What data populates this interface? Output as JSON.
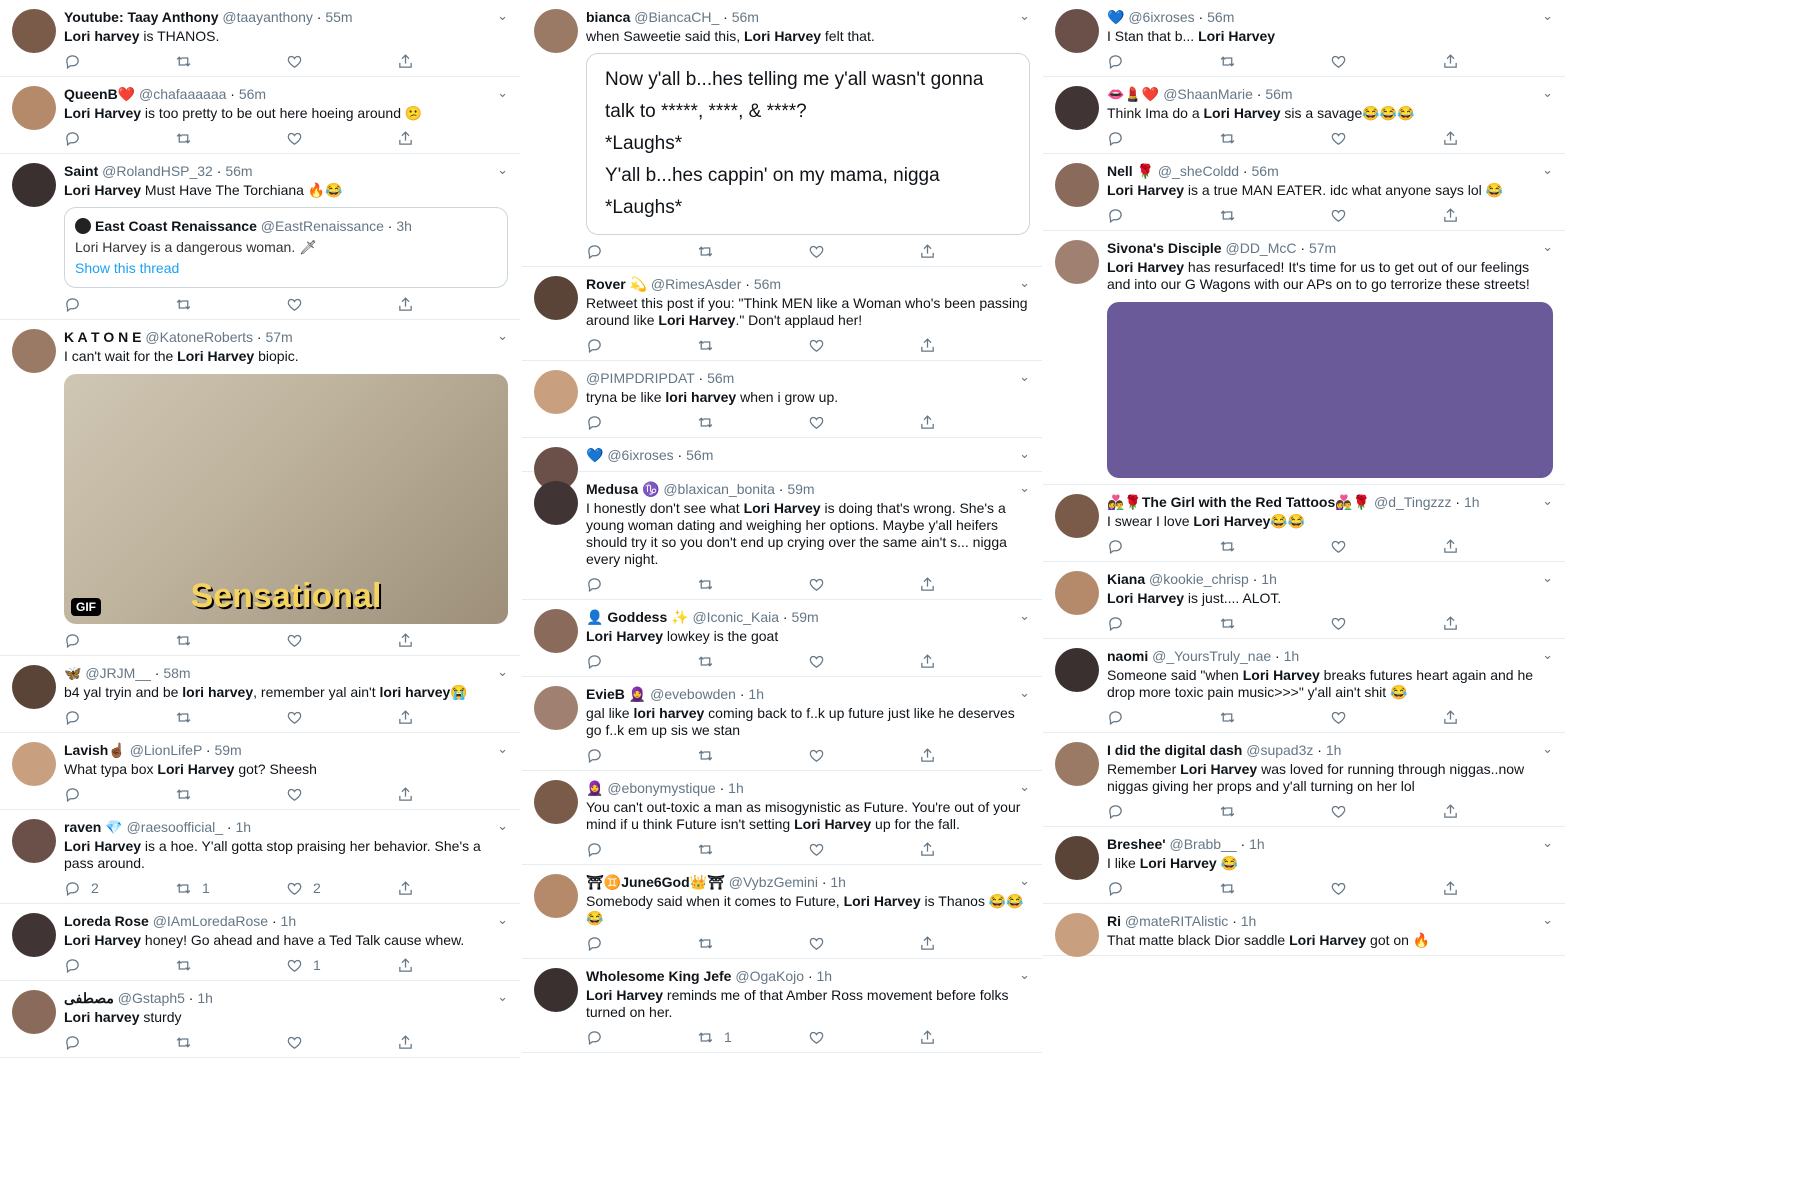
{
  "columns": [
    [
      {
        "name": "Youtube: Taay Anthony",
        "handle": "@taayanthony",
        "time": "55m",
        "text": [
          {
            "t": "Lori harvey",
            "b": true
          },
          {
            "t": " is THANOS."
          }
        ]
      },
      {
        "name": "QueenB❤️",
        "handle": "@chafaaaaaa",
        "time": "56m",
        "text": [
          {
            "t": "Lori Harvey",
            "b": true
          },
          {
            "t": " is too pretty to be out here hoeing around 😕"
          }
        ]
      },
      {
        "name": "Saint",
        "handle": "@RolandHSP_32",
        "time": "56m",
        "text": [
          {
            "t": "Lori Harvey",
            "b": true
          },
          {
            "t": " Must Have The Torchiana 🔥😂"
          }
        ],
        "quote": {
          "name": "East Coast Renaissance",
          "handle": "@EastRenaissance",
          "time": "3h",
          "text": "Lori Harvey is a dangerous woman. 🗡",
          "link": "Show this thread"
        }
      },
      {
        "name": "K A T O N E",
        "handle": "@KatoneRoberts",
        "time": "57m",
        "text": [
          {
            "t": "I can't wait for the "
          },
          {
            "t": "Lori Harvey",
            "b": true
          },
          {
            "t": " biopic."
          }
        ],
        "gif": {
          "caption": "Sensational",
          "badge": "GIF"
        }
      },
      {
        "name": "🦋",
        "handle": "@JRJM__",
        "time": "58m",
        "text": [
          {
            "t": "b4 yal tryin and be "
          },
          {
            "t": "lori harvey",
            "b": true
          },
          {
            "t": ", remember yal ain't "
          },
          {
            "t": "lori harvey",
            "b": true
          },
          {
            "t": "😭"
          }
        ]
      },
      {
        "name": "Lavish☝🏾",
        "handle": "@LionLifeP",
        "time": "59m",
        "text": [
          {
            "t": "What typa box "
          },
          {
            "t": "Lori Harvey",
            "b": true
          },
          {
            "t": " got? Sheesh"
          }
        ]
      },
      {
        "name": "raven 💎",
        "handle": "@raesoofficial_",
        "time": "1h",
        "text": [
          {
            "t": "Lori Harvey",
            "b": true
          },
          {
            "t": " is a hoe. Y'all gotta stop praising her behavior. She's a pass around."
          }
        ],
        "counts": {
          "reply": "2",
          "retweet": "1",
          "like": "2"
        }
      },
      {
        "name": "Loreda Rose",
        "handle": "@IAmLoredaRose",
        "time": "1h",
        "text": [
          {
            "t": "Lori Harvey",
            "b": true
          },
          {
            "t": " honey! Go ahead and have a Ted Talk cause whew."
          }
        ],
        "counts": {
          "like": "1"
        }
      },
      {
        "name": "مصطفى",
        "handle": "@Gstaph5",
        "time": "1h",
        "text": [
          {
            "t": "Lori harvey",
            "b": true
          },
          {
            "t": " sturdy"
          }
        ]
      }
    ],
    [
      {
        "name": "bianca",
        "handle": "@BiancaCH_",
        "time": "56m",
        "text": [
          {
            "t": "when Saweetie said this, "
          },
          {
            "t": "Lori Harvey",
            "b": true
          },
          {
            "t": " felt that."
          }
        ],
        "lyrics": [
          "Now y'all b...hes telling me y'all wasn't gonna",
          "talk to *****, ****, & ****?",
          "*Laughs*",
          "Y'all b...hes cappin' on my mama, nigga",
          "*Laughs*"
        ]
      },
      {
        "name": "Rover 💫",
        "handle": "@RimesAsder",
        "time": "56m",
        "text": [
          {
            "t": "Retweet this post if you: \"Think MEN like a Woman who's been passing around like "
          },
          {
            "t": "Lori Harvey",
            "b": true
          },
          {
            "t": ".\" Don't applaud her!"
          }
        ]
      },
      {
        "name": "",
        "handle": "@PIMPDRIPDAT",
        "time": "56m",
        "text": [
          {
            "t": "tryna be like "
          },
          {
            "t": "lori harvey",
            "b": true
          },
          {
            "t": " when i grow up."
          }
        ]
      },
      {
        "name": "💙",
        "handle": "@6ixroses",
        "time": "56m",
        "text": [],
        "noActions": true
      },
      {
        "name": "Medusa ♑",
        "handle": "@blaxican_bonita",
        "time": "59m",
        "text": [
          {
            "t": "I honestly don't see what "
          },
          {
            "t": "Lori Harvey",
            "b": true
          },
          {
            "t": " is doing that's wrong. She's a young woman dating and weighing her options. Maybe y'all heifers should try it so you don't end up crying over the same ain't s... nigga every night."
          }
        ]
      },
      {
        "name": "👤 Goddess ✨",
        "handle": "@Iconic_Kaia",
        "time": "59m",
        "text": [
          {
            "t": "Lori Harvey",
            "b": true
          },
          {
            "t": " lowkey is the goat"
          }
        ]
      },
      {
        "name": "EvieB 🧕",
        "handle": "@evebowden",
        "time": "1h",
        "text": [
          {
            "t": "gal like "
          },
          {
            "t": "lori harvey",
            "b": true
          },
          {
            "t": " coming back to f..k up future just like he deserves go f..k em up sis we stan"
          }
        ]
      },
      {
        "name": "🧕",
        "handle": "@ebonymystique",
        "time": "1h",
        "text": [
          {
            "t": "You can't out-toxic a man as misogynistic as Future. You're out of your mind if u think Future isn't setting "
          },
          {
            "t": "Lori Harvey",
            "b": true
          },
          {
            "t": " up for the fall."
          }
        ]
      },
      {
        "name": "⛩♊June6God👑⛩",
        "handle": "@VybzGemini",
        "time": "1h",
        "text": [
          {
            "t": "Somebody said when it comes to Future, "
          },
          {
            "t": "Lori Harvey",
            "b": true
          },
          {
            "t": " is Thanos 😂😂😂"
          }
        ]
      },
      {
        "name": "Wholesome King Jefe",
        "handle": "@OgaKojo",
        "time": "1h",
        "text": [
          {
            "t": "Lori Harvey",
            "b": true
          },
          {
            "t": " reminds me of that Amber Ross movement before folks turned on her."
          }
        ],
        "counts": {
          "retweet": "1"
        }
      }
    ],
    [
      {
        "name": "💙",
        "handle": "@6ixroses",
        "time": "56m",
        "text": [
          {
            "t": "I Stan that b... "
          },
          {
            "t": "Lori Harvey",
            "b": true
          }
        ]
      },
      {
        "name": "👄💄❤️",
        "handle": "@ShaanMarie",
        "time": "56m",
        "text": [
          {
            "t": "Think Ima do a "
          },
          {
            "t": "Lori Harvey",
            "b": true
          },
          {
            "t": " sis a savage😂😂😂"
          }
        ]
      },
      {
        "name": "Nell 🌹",
        "handle": "@_sheColdd",
        "time": "56m",
        "text": [
          {
            "t": "Lori Harvey",
            "b": true
          },
          {
            "t": " is a true MAN EATER. idc what anyone says lol 😂"
          }
        ]
      },
      {
        "name": "Sivona's Disciple",
        "handle": "@DD_McC",
        "time": "57m",
        "text": [
          {
            "t": "Lori Harvey",
            "b": true
          },
          {
            "t": " has resurfaced! It's time for us to get out of our feelings and into our G Wagons with our APs on to go terrorize these streets!"
          }
        ],
        "cartoon": true,
        "noActions": true
      },
      {
        "name": "👩‍❤️‍👨🌹The Girl with the Red Tattoos👩‍❤️‍👨🌹",
        "handle": "@d_Tingzzz",
        "time": "1h",
        "text": [
          {
            "t": "I swear I love "
          },
          {
            "t": "Lori Harvey",
            "b": true
          },
          {
            "t": "😂😂"
          }
        ]
      },
      {
        "name": "Kiana",
        "handle": "@kookie_chrisp",
        "time": "1h",
        "text": [
          {
            "t": "Lori Harvey",
            "b": true
          },
          {
            "t": " is just.... ALOT."
          }
        ]
      },
      {
        "name": "naomi",
        "handle": "@_YoursTruly_nae",
        "time": "1h",
        "text": [
          {
            "t": "Someone said \"when "
          },
          {
            "t": "Lori Harvey",
            "b": true
          },
          {
            "t": " breaks futures heart again and he drop more toxic pain music>>>\" y'all ain't shit 😂"
          }
        ]
      },
      {
        "name": "I did the digital dash",
        "handle": "@supad3z",
        "time": "1h",
        "text": [
          {
            "t": "Remember "
          },
          {
            "t": "Lori Harvey",
            "b": true
          },
          {
            "t": " was loved for running through niggas..now niggas giving her props and y'all turning on her lol"
          }
        ]
      },
      {
        "name": "Breshee'",
        "handle": "@Brabb__",
        "time": "1h",
        "text": [
          {
            "t": "I like "
          },
          {
            "t": "Lori Harvey",
            "b": true
          },
          {
            "t": " 😂"
          }
        ]
      },
      {
        "name": "Ri",
        "handle": "@mateRITAlistic",
        "time": "1h",
        "text": [
          {
            "t": "That matte black Dior saddle "
          },
          {
            "t": "Lori Harvey",
            "b": true
          },
          {
            "t": " got on 🔥"
          }
        ],
        "noActions": true
      }
    ]
  ],
  "colors": {
    "text": "#0f1419",
    "secondary": "#657786",
    "accent": "#1da1f2",
    "border": "#e6ecf0"
  }
}
